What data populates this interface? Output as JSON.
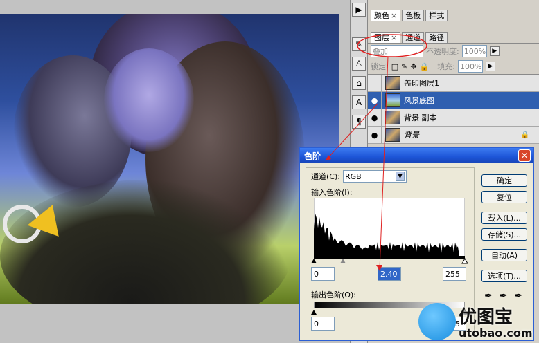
{
  "panels": {
    "top_tabs": [
      "颜色",
      "色板",
      "样式"
    ],
    "layer_tabs": [
      "图层",
      "通道",
      "路径"
    ],
    "blend_mode": "叠加",
    "opacity_label": "不透明度:",
    "opacity_value": "100%",
    "lock_label": "锁定:",
    "fill_label": "填充:",
    "fill_value": "100%",
    "layers": [
      {
        "name": "盖印图层1",
        "visible": false,
        "selected": false
      },
      {
        "name": "风景底图",
        "visible": true,
        "selected": true
      },
      {
        "name": "背景 副本",
        "visible": true,
        "selected": false
      },
      {
        "name": "背景",
        "visible": true,
        "selected": false,
        "locked": true
      }
    ]
  },
  "dialog": {
    "title": "色阶",
    "channel_label": "通道(C):",
    "channel_value": "RGB",
    "input_label": "输入色阶(I):",
    "input_black": "0",
    "input_gamma": "2.40",
    "input_white": "255",
    "output_label": "输出色阶(O):",
    "output_black": "0",
    "output_white": "255",
    "buttons": [
      "确定",
      "复位",
      "载入(L)...",
      "存储(S)...",
      "自动(A)",
      "选项(T)..."
    ]
  },
  "watermark": {
    "brand": "优图宝",
    "url": "utobao.com"
  },
  "colors": {
    "dialog_title": "#1c54d6",
    "selected_layer": "#2f5fb0",
    "annotation_red": "#e02020"
  }
}
